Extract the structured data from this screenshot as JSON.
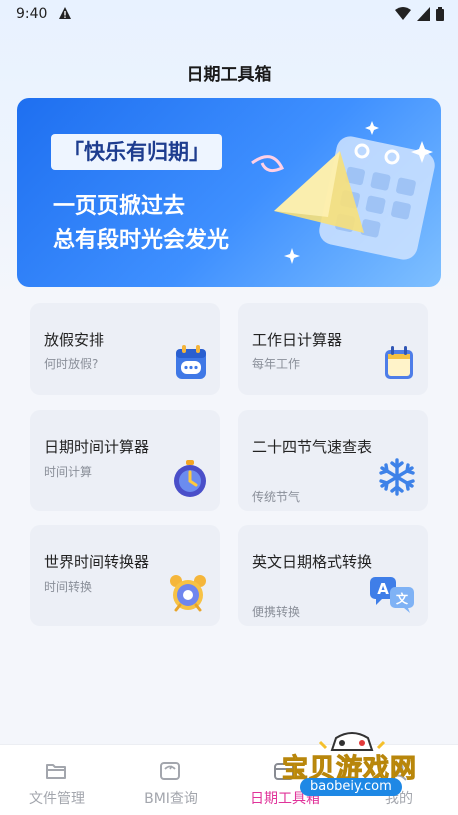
{
  "status_bar": {
    "time": "9:40"
  },
  "header": {
    "title": "日期工具箱"
  },
  "banner": {
    "tag": "「快乐有归期」",
    "line1": "一页页掀过去",
    "line2": "总有段时光会发光"
  },
  "tools": [
    {
      "title": "放假安排",
      "subtitle": "何时放假?",
      "icon": "calendar-chat-icon"
    },
    {
      "title": "工作日计算器",
      "subtitle": "每年工作",
      "icon": "calendar-icon"
    },
    {
      "title": "日期时间计算器",
      "subtitle": "时间计算",
      "icon": "stopwatch-icon"
    },
    {
      "title": "二十四节气速查表",
      "subtitle": "传统节气",
      "icon": "snowflake-icon"
    },
    {
      "title": "世界时间转换器",
      "subtitle": "时间转换",
      "icon": "alarm-clock-icon"
    },
    {
      "title": "英文日期格式转换",
      "subtitle": "便携转换",
      "icon": "translate-icon"
    }
  ],
  "tabs": [
    {
      "label": "文件管理",
      "icon": "folder-icon",
      "active": false
    },
    {
      "label": "BMI查询",
      "icon": "scale-icon",
      "active": false
    },
    {
      "label": "日期工具箱",
      "icon": "calendar-tab-icon",
      "active": true
    },
    {
      "label": "我的",
      "icon": "user-icon",
      "active": false
    }
  ],
  "watermark": {
    "name": "宝贝游戏网",
    "url": "baobeiy.com"
  },
  "colors": {
    "accent": "#e0339a",
    "banner": "#2f7ff5"
  }
}
